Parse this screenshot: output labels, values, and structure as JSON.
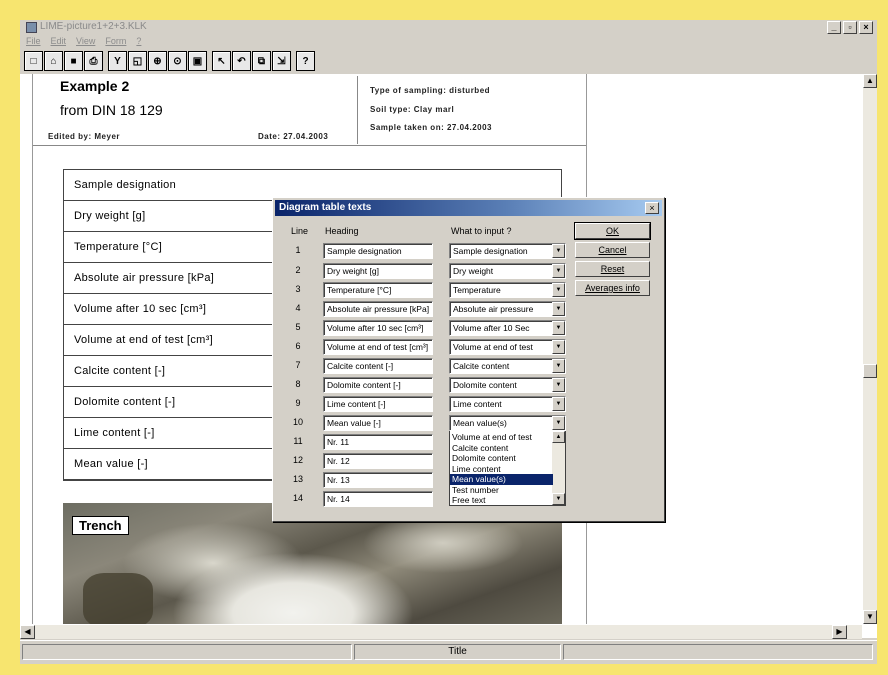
{
  "window": {
    "title": "LIME-picture1+2+3.KLK",
    "controls": [
      "_",
      "▫",
      "×"
    ]
  },
  "menu": [
    "File",
    "Edit",
    "View",
    "Form",
    "?"
  ],
  "toolbar": {
    "buttons": [
      {
        "name": "new-icon",
        "glyph": "□"
      },
      {
        "name": "open-icon",
        "glyph": "⌂"
      },
      {
        "name": "save-icon",
        "glyph": "■"
      },
      {
        "name": "print-icon",
        "glyph": "⎙"
      },
      {
        "name": "filter-icon",
        "glyph": "Y"
      },
      {
        "name": "preview-icon",
        "glyph": "◱"
      },
      {
        "name": "zoom-in-icon",
        "glyph": "⊕"
      },
      {
        "name": "zoom-icon",
        "glyph": "⊙"
      },
      {
        "name": "page-icon",
        "glyph": "▣"
      },
      {
        "name": "pointer-icon",
        "glyph": "↖"
      },
      {
        "name": "undo-icon",
        "glyph": "↶"
      },
      {
        "name": "copy-icon",
        "glyph": "⧉"
      },
      {
        "name": "export-icon",
        "glyph": "⇲"
      },
      {
        "name": "help-icon",
        "glyph": "?"
      }
    ]
  },
  "document": {
    "title": "Example 2",
    "subtitle": "from DIN 18 129",
    "edited_by": "Edited by:  Meyer",
    "date": "Date: 27.04.2003",
    "type_of_sampling": "Type of sampling:  disturbed",
    "soil_type": "Soil type:  Clay marl",
    "sample_taken": "Sample taken on:  27.04.2003",
    "table_rows": [
      "Sample designation",
      "Dry weight [g]",
      "Temperature [°C]",
      "Absolute air pressure [kPa]",
      "Volume after 10 sec [cm³]",
      "Volume at end of test [cm³]",
      "Calcite content [-]",
      "Dolomite content [-]",
      "Lime content [-]",
      "Mean value [-]"
    ],
    "photo_label": "Trench"
  },
  "dialog": {
    "title": "Diagram table texts",
    "col_line": "Line",
    "col_heading": "Heading",
    "col_input": "What to input ?",
    "rows": [
      {
        "line": "1",
        "heading": "Sample designation",
        "input": "Sample designation"
      },
      {
        "line": "2",
        "heading": "Dry weight [g]",
        "input": "Dry weight"
      },
      {
        "line": "3",
        "heading": "Temperature [°C]",
        "input": "Temperature"
      },
      {
        "line": "4",
        "heading": "Absolute air pressure [kPa]",
        "input": "Absolute air pressure"
      },
      {
        "line": "5",
        "heading": "Volume after 10 sec [cm³]",
        "input": "Volume after 10 Sec"
      },
      {
        "line": "6",
        "heading": "Volume at end of test [cm³]",
        "input": "Volume at end of test"
      },
      {
        "line": "7",
        "heading": "Calcite content [-]",
        "input": "Calcite content"
      },
      {
        "line": "8",
        "heading": "Dolomite content [-]",
        "input": "Dolomite content"
      },
      {
        "line": "9",
        "heading": "Lime content [-]",
        "input": "Lime content"
      },
      {
        "line": "10",
        "heading": "Mean value [-]",
        "input": "Mean value(s)"
      },
      {
        "line": "11",
        "heading": "Nr. 11"
      },
      {
        "line": "12",
        "heading": "Nr. 12"
      },
      {
        "line": "13",
        "heading": "Nr. 13"
      },
      {
        "line": "14",
        "heading": "Nr. 14"
      }
    ],
    "dropdown_options": [
      "Volume at end of test",
      "Calcite content",
      "Dolomite content",
      "Lime content",
      "Mean value(s)",
      "Test number",
      "Free text"
    ],
    "dropdown_selected": "Mean value(s)",
    "buttons": {
      "ok": "OK",
      "cancel": "Cancel",
      "reset": "Reset",
      "averages": "Averages info"
    }
  },
  "statusbar": {
    "text": "Title"
  }
}
